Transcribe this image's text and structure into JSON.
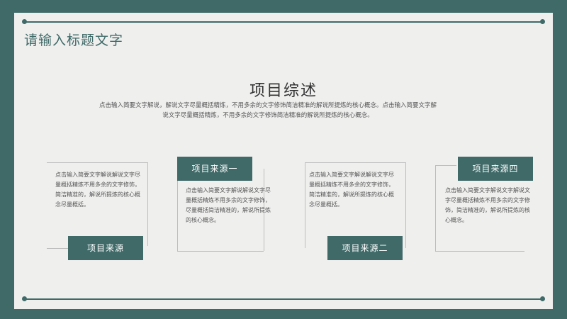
{
  "title": "请输入标题文字",
  "heading": "项目综述",
  "intro": "点击输入简要文字解说，解说文字尽量概括精炼，不用多余的文字修饰简洁精准的解说所提炼的核心概念。点击输入简要文字解说文字尽量概括精炼，不用多余的文字修饰简洁精准的解说所提炼的核心概念。",
  "cards": [
    {
      "label": "项目来源",
      "text": "点击输入简要文字解说解说文字尽量概括精炼不用多余的文字修饰，简洁精准的，解说所提炼的核心概念尽量概括。"
    },
    {
      "label": "项目来源一",
      "text": "点击输入简要文字解说解说文字尽量概括精炼不用多余的文字修饰，尽量概括简洁精准的，解说所提炼的核心概念。"
    },
    {
      "label": "项目来源二",
      "text": "点击输入简要文字解说解说文字尽量概括精炼不用多余的文字修饰，简洁精准的，解说所提炼的核心概念尽量概括。"
    },
    {
      "label": "项目来源四",
      "text": "点击输入简要文字解说文字解说文字尽量概括精炼不用多余的文字修饰，简洁精准的，解说所提炼的核心概念。"
    }
  ]
}
